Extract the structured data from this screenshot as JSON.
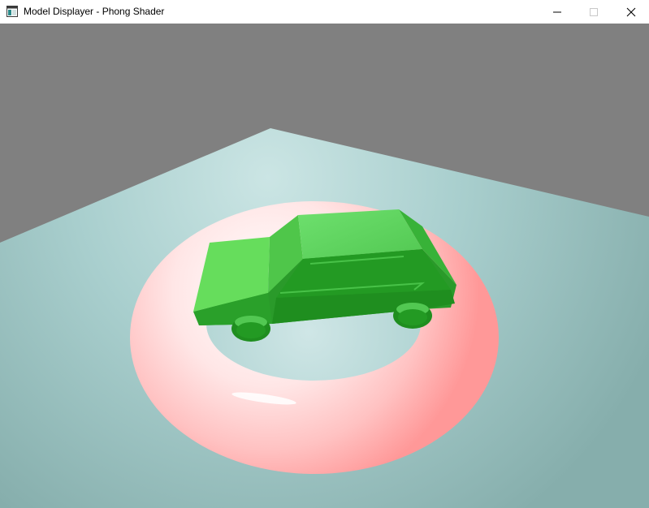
{
  "window": {
    "title": "Model Displayer - Phong Shader",
    "controls": [
      "minimize",
      "maximize",
      "close"
    ]
  },
  "scene": {
    "background_color": "#808080",
    "floor_color": "#9fc4c3",
    "torus_color": "#ffb0b0",
    "car_color": "#3fbf3f",
    "objects": [
      "floor-plane",
      "torus",
      "car"
    ]
  }
}
